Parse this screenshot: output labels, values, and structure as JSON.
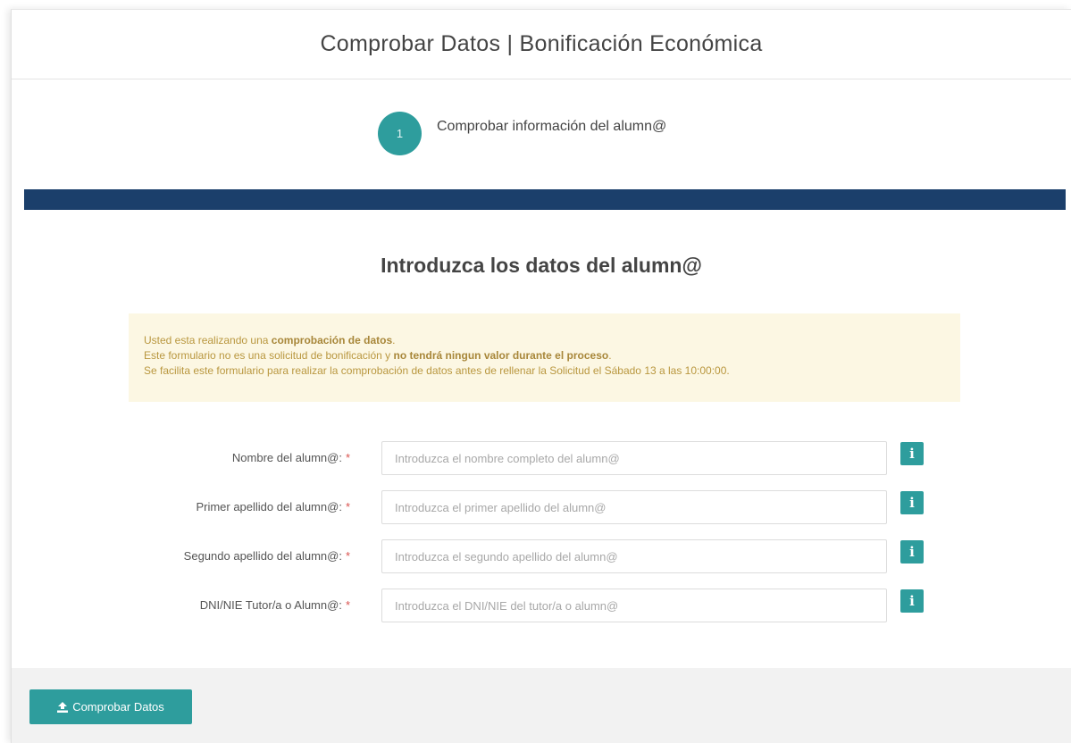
{
  "header": {
    "title": "Comprobar Datos | Bonificación Económica"
  },
  "stepper": {
    "step_number": "1",
    "step_label": "Comprobar información del alumn@"
  },
  "section": {
    "title": "Introduzca los datos del alumn@"
  },
  "alert": {
    "line1_prefix": "Usted esta realizando una ",
    "line1_bold": "comprobación de datos",
    "line1_suffix": ".",
    "line2_prefix": "Este formulario no es una solicitud de bonificación y ",
    "line2_bold": "no tendrá ningun valor durante el proceso",
    "line2_suffix": ".",
    "line3": "Se facilita este formulario para realizar la comprobación de datos antes de rellenar la Solicitud el Sábado 13 a las 10:00:00."
  },
  "form": {
    "required_mark": "*",
    "info_glyph": "i",
    "fields": [
      {
        "label": "Nombre del alumn@:",
        "placeholder": "Introduzca el nombre completo del alumn@",
        "value": ""
      },
      {
        "label": "Primer apellido del alumn@:",
        "placeholder": "Introduzca el primer apellido del alumn@",
        "value": ""
      },
      {
        "label": "Segundo apellido del alumn@:",
        "placeholder": "Introduzca el segundo apellido del alumn@",
        "value": ""
      },
      {
        "label": "DNI/NIE Tutor/a o Alumn@:",
        "placeholder": "Introduzca el DNI/NIE del tutor/a o alumn@",
        "value": ""
      }
    ]
  },
  "footer": {
    "submit_label": "Comprobar Datos",
    "submit_icon": "upload-icon"
  },
  "colors": {
    "accent": "#2e9d9d",
    "navy_bar": "#1b3f6b",
    "alert_bg": "#fcf7e3",
    "alert_text": "#b9973f",
    "required": "#d9534f"
  }
}
